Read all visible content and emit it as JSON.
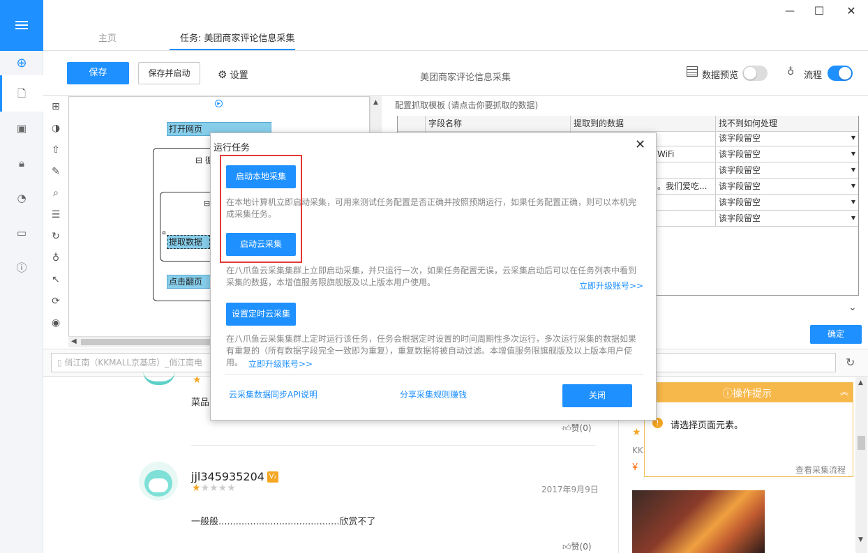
{
  "window": {
    "minimize": "—",
    "maximize": "☐",
    "close": "✕"
  },
  "tabs": {
    "home": "主页",
    "task": "任务: 美团商家评论信息采集"
  },
  "toolbar": {
    "save": "保存",
    "save_and_start": "保存并启动",
    "settings": "设置",
    "task_title": "美团商家评论信息采集",
    "data_preview": "数据预览",
    "flow": "流程"
  },
  "flow": {
    "open_page": "打开网页",
    "loop_label": "循",
    "extract": "提取数据",
    "click_next": "点击翻页"
  },
  "config": {
    "header": "配置抓取模板 (请点击你要抓取的数据)",
    "columns": [
      "字段名称",
      "提取到的数据",
      "找不到如何处理"
    ],
    "rows": [
      {
        "data": "",
        "handling": "该字段留空"
      },
      {
        "data": "WiFi",
        "handling": "该字段留空"
      },
      {
        "data": "",
        "handling": "该字段留空"
      },
      {
        "data": "。我们爱吃...",
        "handling": "该字段留空"
      },
      {
        "data": "",
        "handling": "该字段留空"
      },
      {
        "data": "",
        "handling": "该字段留空"
      }
    ],
    "confirm": "确定"
  },
  "address_bar": {
    "value": "俏江南（KKMALL京基店）_俏江南电"
  },
  "modal": {
    "title": "运行任务",
    "local_btn": "启动本地采集",
    "local_desc": "在本地计算机立即启动采集，可用来测试任务配置是否正确并按照预期运行，如果任务配置正确，则可以本机完成采集任务。",
    "cloud_btn": "启动云采集",
    "cloud_desc": "在八爪鱼云采集集群上立即启动采集，并只运行一次，如果任务配置无误，云采集启动后可以在任务列表中看到采集的数据，本增值服务限旗舰版及以上版本用户使用。",
    "cloud_upgrade": "立即升级账号>>",
    "timed_btn": "设置定时云采集",
    "timed_desc": "在八爪鱼云采集集群上定时运行该任务，任务会根据定时设置的时间周期性多次运行，多次运行采集的数据如果有重复的（所有数据字段完全一致即为重复），重复数据将被自动过滤。本增值服务限旗舰版及以上版本用户使用。",
    "timed_upgrade": "立即升级账号>>",
    "api_link": "云采集数据同步API说明",
    "share_link": "分享采集规则赚钱",
    "close_btn": "关闭"
  },
  "review1": {
    "text": "菜品",
    "like": "赞(0)"
  },
  "review2": {
    "user": "jjl345935204",
    "badge": "V₂",
    "date": "2017年9月9日",
    "text": "一般般..........................................欣赏不了",
    "like": "赞(0)"
  },
  "side_panel": {
    "kk": "KK",
    "yen": "¥"
  },
  "tip": {
    "title": "操作提示",
    "message": "请选择页面元素。",
    "footer": "查看采集流程"
  },
  "colors": {
    "accent": "#1e90ff",
    "highlight": "#e53935",
    "tip": "#f7b84b"
  }
}
